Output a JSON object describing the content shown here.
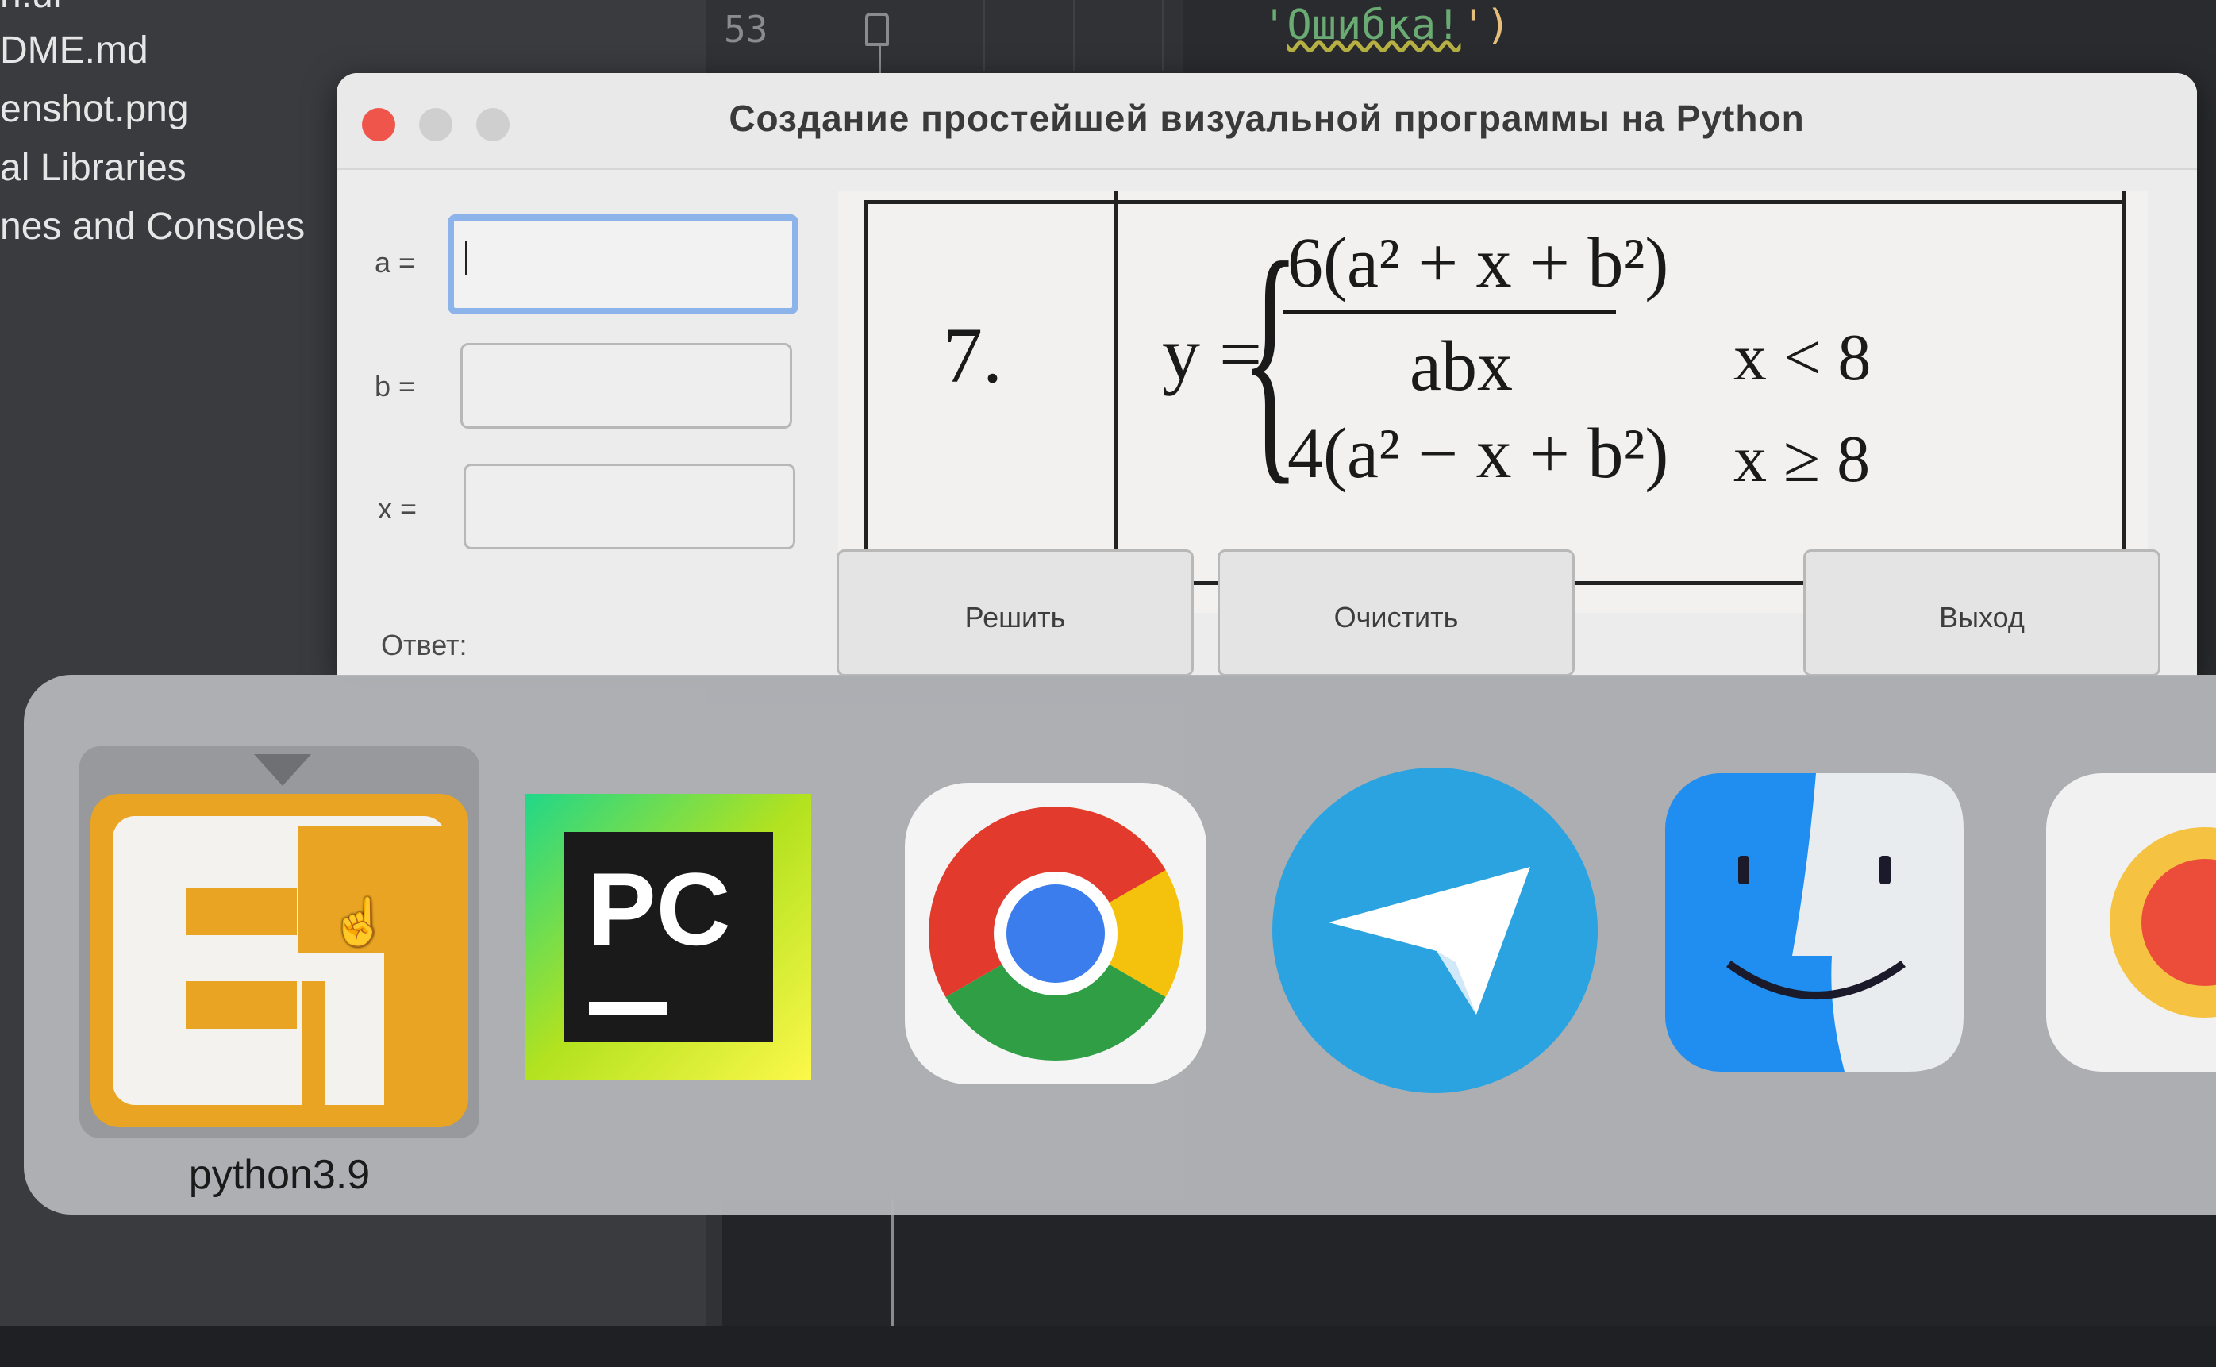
{
  "ide": {
    "project_items": [
      "DME.md",
      "enshot.png",
      "al Libraries",
      "nes and Consoles"
    ],
    "top_partial": "n.ui",
    "line_number": "53",
    "code_open": "'",
    "code_error_text": "Ошибка!",
    "code_close": "')"
  },
  "window": {
    "title": "Создание простейшей визуальной программы на Python",
    "fields": [
      {
        "label": "a =",
        "value": ""
      },
      {
        "label": "b =",
        "value": ""
      },
      {
        "label": "x =",
        "value": ""
      }
    ],
    "answer_label": "Ответ:",
    "buttons": {
      "solve": "Решить",
      "clear": "Очистить",
      "exit": "Выход"
    }
  },
  "formula": {
    "task_number": "7.",
    "lhs": "y =",
    "case1_numerator": "6(a² + x + b²)",
    "case1_denominator": "abx",
    "case1_condition": "x < 8",
    "case2_expression": "4(a² − x + b²)",
    "case2_condition": "x ≥ 8"
  },
  "switcher": {
    "selected_app_label": "python3.9",
    "apps": [
      "python3.9",
      "PyCharm",
      "Chrome",
      "Telegram",
      "Finder",
      "Other"
    ],
    "pycharm_text": "PC"
  },
  "colors": {
    "close_red": "#f0554b",
    "focus_ring": "#8cb3ea",
    "python_orange": "#e8a422",
    "telegram_blue": "#2aa3e0",
    "finder_blue": "#1f8ef0"
  }
}
